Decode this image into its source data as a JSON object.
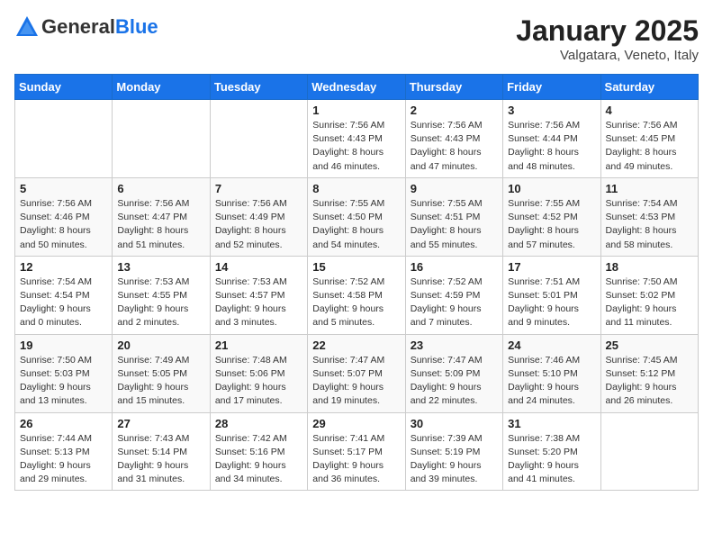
{
  "header": {
    "logo": {
      "general": "General",
      "blue": "Blue"
    },
    "month": "January 2025",
    "location": "Valgatara, Veneto, Italy"
  },
  "weekdays": [
    "Sunday",
    "Monday",
    "Tuesday",
    "Wednesday",
    "Thursday",
    "Friday",
    "Saturday"
  ],
  "weeks": [
    [
      {
        "day": "",
        "info": ""
      },
      {
        "day": "",
        "info": ""
      },
      {
        "day": "",
        "info": ""
      },
      {
        "day": "1",
        "info": "Sunrise: 7:56 AM\nSunset: 4:43 PM\nDaylight: 8 hours and 46 minutes."
      },
      {
        "day": "2",
        "info": "Sunrise: 7:56 AM\nSunset: 4:43 PM\nDaylight: 8 hours and 47 minutes."
      },
      {
        "day": "3",
        "info": "Sunrise: 7:56 AM\nSunset: 4:44 PM\nDaylight: 8 hours and 48 minutes."
      },
      {
        "day": "4",
        "info": "Sunrise: 7:56 AM\nSunset: 4:45 PM\nDaylight: 8 hours and 49 minutes."
      }
    ],
    [
      {
        "day": "5",
        "info": "Sunrise: 7:56 AM\nSunset: 4:46 PM\nDaylight: 8 hours and 50 minutes."
      },
      {
        "day": "6",
        "info": "Sunrise: 7:56 AM\nSunset: 4:47 PM\nDaylight: 8 hours and 51 minutes."
      },
      {
        "day": "7",
        "info": "Sunrise: 7:56 AM\nSunset: 4:49 PM\nDaylight: 8 hours and 52 minutes."
      },
      {
        "day": "8",
        "info": "Sunrise: 7:55 AM\nSunset: 4:50 PM\nDaylight: 8 hours and 54 minutes."
      },
      {
        "day": "9",
        "info": "Sunrise: 7:55 AM\nSunset: 4:51 PM\nDaylight: 8 hours and 55 minutes."
      },
      {
        "day": "10",
        "info": "Sunrise: 7:55 AM\nSunset: 4:52 PM\nDaylight: 8 hours and 57 minutes."
      },
      {
        "day": "11",
        "info": "Sunrise: 7:54 AM\nSunset: 4:53 PM\nDaylight: 8 hours and 58 minutes."
      }
    ],
    [
      {
        "day": "12",
        "info": "Sunrise: 7:54 AM\nSunset: 4:54 PM\nDaylight: 9 hours and 0 minutes."
      },
      {
        "day": "13",
        "info": "Sunrise: 7:53 AM\nSunset: 4:55 PM\nDaylight: 9 hours and 2 minutes."
      },
      {
        "day": "14",
        "info": "Sunrise: 7:53 AM\nSunset: 4:57 PM\nDaylight: 9 hours and 3 minutes."
      },
      {
        "day": "15",
        "info": "Sunrise: 7:52 AM\nSunset: 4:58 PM\nDaylight: 9 hours and 5 minutes."
      },
      {
        "day": "16",
        "info": "Sunrise: 7:52 AM\nSunset: 4:59 PM\nDaylight: 9 hours and 7 minutes."
      },
      {
        "day": "17",
        "info": "Sunrise: 7:51 AM\nSunset: 5:01 PM\nDaylight: 9 hours and 9 minutes."
      },
      {
        "day": "18",
        "info": "Sunrise: 7:50 AM\nSunset: 5:02 PM\nDaylight: 9 hours and 11 minutes."
      }
    ],
    [
      {
        "day": "19",
        "info": "Sunrise: 7:50 AM\nSunset: 5:03 PM\nDaylight: 9 hours and 13 minutes."
      },
      {
        "day": "20",
        "info": "Sunrise: 7:49 AM\nSunset: 5:05 PM\nDaylight: 9 hours and 15 minutes."
      },
      {
        "day": "21",
        "info": "Sunrise: 7:48 AM\nSunset: 5:06 PM\nDaylight: 9 hours and 17 minutes."
      },
      {
        "day": "22",
        "info": "Sunrise: 7:47 AM\nSunset: 5:07 PM\nDaylight: 9 hours and 19 minutes."
      },
      {
        "day": "23",
        "info": "Sunrise: 7:47 AM\nSunset: 5:09 PM\nDaylight: 9 hours and 22 minutes."
      },
      {
        "day": "24",
        "info": "Sunrise: 7:46 AM\nSunset: 5:10 PM\nDaylight: 9 hours and 24 minutes."
      },
      {
        "day": "25",
        "info": "Sunrise: 7:45 AM\nSunset: 5:12 PM\nDaylight: 9 hours and 26 minutes."
      }
    ],
    [
      {
        "day": "26",
        "info": "Sunrise: 7:44 AM\nSunset: 5:13 PM\nDaylight: 9 hours and 29 minutes."
      },
      {
        "day": "27",
        "info": "Sunrise: 7:43 AM\nSunset: 5:14 PM\nDaylight: 9 hours and 31 minutes."
      },
      {
        "day": "28",
        "info": "Sunrise: 7:42 AM\nSunset: 5:16 PM\nDaylight: 9 hours and 34 minutes."
      },
      {
        "day": "29",
        "info": "Sunrise: 7:41 AM\nSunset: 5:17 PM\nDaylight: 9 hours and 36 minutes."
      },
      {
        "day": "30",
        "info": "Sunrise: 7:39 AM\nSunset: 5:19 PM\nDaylight: 9 hours and 39 minutes."
      },
      {
        "day": "31",
        "info": "Sunrise: 7:38 AM\nSunset: 5:20 PM\nDaylight: 9 hours and 41 minutes."
      },
      {
        "day": "",
        "info": ""
      }
    ]
  ]
}
